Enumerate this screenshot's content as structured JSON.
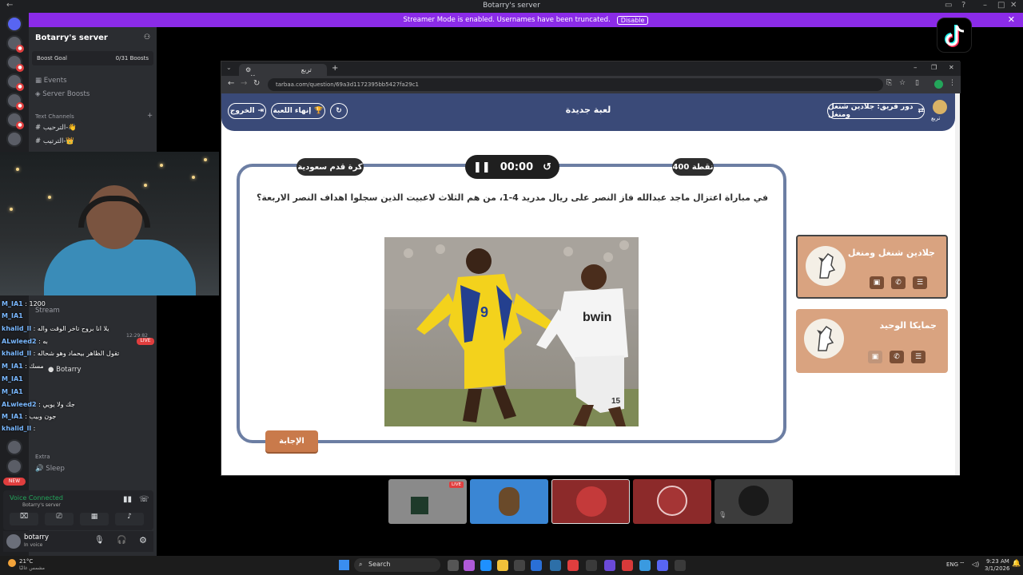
{
  "window": {
    "title": "Botarry's server"
  },
  "streamer_banner": {
    "text": "Streamer Mode is enabled. Usernames have been truncated.",
    "disable_label": "Disable"
  },
  "discord": {
    "server_name": "Botarry's server",
    "boost_goal": "Boost Goal",
    "boost_count": "0/31 Boosts",
    "events_label": "Events",
    "server_boosts_label": "Server Boosts",
    "text_channels_label": "Text Channels",
    "channels": [
      "الترحيب-👋",
      "الترتيب-👑"
    ],
    "voice_section_items": [
      "Stream",
      "Botarry"
    ],
    "extra_label": "Extra",
    "sleep_label": "Sleep",
    "voice_connected": "Voice Connected",
    "voice_server": "Botarry's server",
    "username": "botarry",
    "user_status": "In voice",
    "new_badge": "NEW",
    "live_badge": "LIVE",
    "timestamp": "12:29:82"
  },
  "chat_overlay": [
    {
      "user": "M_IA1",
      "text": ": 1200"
    },
    {
      "user": "M_IA1",
      "text": ""
    },
    {
      "user": "khalid_ll",
      "text": ": يلا انا بروح تاخر الوقت واله"
    },
    {
      "user": "ALwleed2",
      "text": ": به"
    },
    {
      "user": "khalid_ll",
      "text": ": تقول الظاهر بيحماد وهو شحاله"
    },
    {
      "user": "M_IA1",
      "text": ": مسك"
    },
    {
      "user": "M_IA1",
      "text": ""
    },
    {
      "user": "M_IA1",
      "text": ""
    },
    {
      "user": "ALwleed2",
      "text": ": جك ولا يويي"
    },
    {
      "user": "M_IA1",
      "text": ": جون وبيب"
    },
    {
      "user": "khalid_ll",
      "text": ":"
    }
  ],
  "browser": {
    "tab_title": "تربع",
    "url": "tarbaa.com/question/69a3d1172395bb5427fa29c1"
  },
  "game": {
    "exit_label": "الخروج",
    "end_game_label": "إنهاء اللعبة",
    "title": "لعبة جديدة",
    "turn_label": "دور فريق: جلادين شنغل ومنغل",
    "logo_label": "تربع",
    "category": "كرة قدم سعودية",
    "points": "400 نقطة",
    "timer": "00:00",
    "question": "في مباراة اعتزال ماجد عبدالله فاز النصر على ريال مدريد 4-1، من هم الثلاث لاعبيت الذين سجلوا اهداف النصر الاربعة؟",
    "answer_label": "الإجابة",
    "teams": [
      {
        "name": "جلادين شنغل ومنغل",
        "active": true
      },
      {
        "name": "جمايكا الوحيد",
        "active": false
      }
    ]
  },
  "photo": {
    "shirt_number_left": "9",
    "sponsor_right": "bwin",
    "shirt_number_right": "15"
  },
  "taskbar": {
    "weather_temp": "21°C",
    "weather_desc": "مشمس غالبًا",
    "search_label": "Search",
    "lang": "ENG",
    "time": "9:23 AM",
    "date": "3/1/2026"
  },
  "colors": {
    "header": "#3a4a78",
    "accent": "#c97a4b",
    "team_card": "#d9a380",
    "streamer_bar": "#8b2be8"
  },
  "icons": [
    "pause-icon",
    "history-icon",
    "trophy-icon",
    "refresh-icon",
    "shuffle-icon",
    "phone-icon",
    "list-icon",
    "image-icon",
    "tiktok-icon",
    "search-icon"
  ]
}
